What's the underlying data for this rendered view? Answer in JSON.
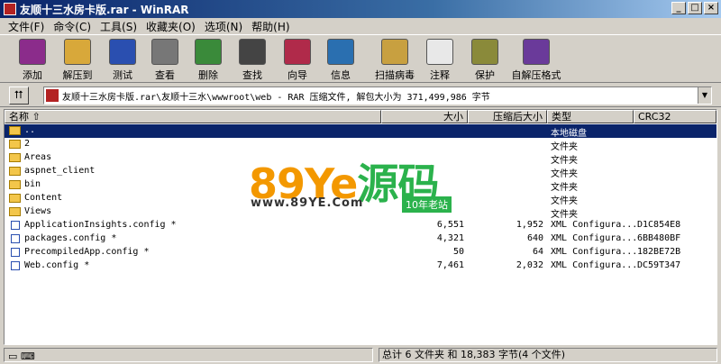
{
  "window": {
    "title": "友顺十三水房卡版.rar - WinRAR"
  },
  "menu": [
    "文件(F)",
    "命令(C)",
    "工具(S)",
    "收藏夹(O)",
    "选项(N)",
    "帮助(H)"
  ],
  "toolbar": [
    {
      "label": "添加",
      "icon": "add-icon",
      "color": "#8b2c8b"
    },
    {
      "label": "解压到",
      "icon": "extract-to-icon",
      "color": "#d8a83a"
    },
    {
      "label": "测试",
      "icon": "test-icon",
      "color": "#2a4fb0"
    },
    {
      "label": "查看",
      "icon": "view-icon",
      "color": "#777777"
    },
    {
      "label": "删除",
      "icon": "delete-icon",
      "color": "#3a8a3a"
    },
    {
      "label": "查找",
      "icon": "find-icon",
      "color": "#444444"
    },
    {
      "label": "向导",
      "icon": "wizard-icon",
      "color": "#b02a4a"
    },
    {
      "label": "信息",
      "icon": "info-icon",
      "color": "#2a6fb0"
    },
    {
      "label": "扫描病毒",
      "icon": "scan-virus-icon",
      "color": "#c8a040"
    },
    {
      "label": "注释",
      "icon": "comment-icon",
      "color": "#e8e8e8"
    },
    {
      "label": "保护",
      "icon": "protect-icon",
      "color": "#8a8a3a"
    },
    {
      "label": "自解压格式",
      "icon": "sfx-icon",
      "color": "#6a3a9a"
    }
  ],
  "address": {
    "path": "友顺十三水房卡版.rar\\友顺十三水\\wwwroot\\web - RAR 压缩文件, 解包大小为 371,499,986 字节"
  },
  "columns": {
    "name": "名称",
    "size": "大小",
    "packed": "压缩后大小",
    "type": "类型",
    "crc": "CRC32"
  },
  "files": [
    {
      "name": "..",
      "size": "",
      "packed": "",
      "type": "本地磁盘",
      "crc": "",
      "kind": "folder"
    },
    {
      "name": "2",
      "size": "",
      "packed": "",
      "type": "文件夹",
      "crc": "",
      "kind": "folder"
    },
    {
      "name": "Areas",
      "size": "",
      "packed": "",
      "type": "文件夹",
      "crc": "",
      "kind": "folder"
    },
    {
      "name": "aspnet_client",
      "size": "",
      "packed": "",
      "type": "文件夹",
      "crc": "",
      "kind": "folder"
    },
    {
      "name": "bin",
      "size": "",
      "packed": "",
      "type": "文件夹",
      "crc": "",
      "kind": "folder"
    },
    {
      "name": "Content",
      "size": "",
      "packed": "",
      "type": "文件夹",
      "crc": "",
      "kind": "folder"
    },
    {
      "name": "Views",
      "size": "",
      "packed": "",
      "type": "文件夹",
      "crc": "",
      "kind": "folder"
    },
    {
      "name": "ApplicationInsights.config *",
      "size": "6,551",
      "packed": "1,952",
      "type": "XML Configura...",
      "crc": "D1C854E8",
      "kind": "file"
    },
    {
      "name": "packages.config *",
      "size": "4,321",
      "packed": "640",
      "type": "XML Configura...",
      "crc": "6BB480BF",
      "kind": "file"
    },
    {
      "name": "PrecompiledApp.config *",
      "size": "50",
      "packed": "64",
      "type": "XML Configura...",
      "crc": "182BE72B",
      "kind": "file"
    },
    {
      "name": "Web.config *",
      "size": "7,461",
      "packed": "2,032",
      "type": "XML Configura...",
      "crc": "DC59T347",
      "kind": "file"
    }
  ],
  "watermark": {
    "brand_num": "89Y",
    "brand_e": "e",
    "brand_cn": "源码",
    "url": "www.89YE.Com",
    "badge": "10年老站"
  },
  "status": {
    "summary": "总计 6 文件夹 和 18,383 字节(4 个文件)"
  }
}
